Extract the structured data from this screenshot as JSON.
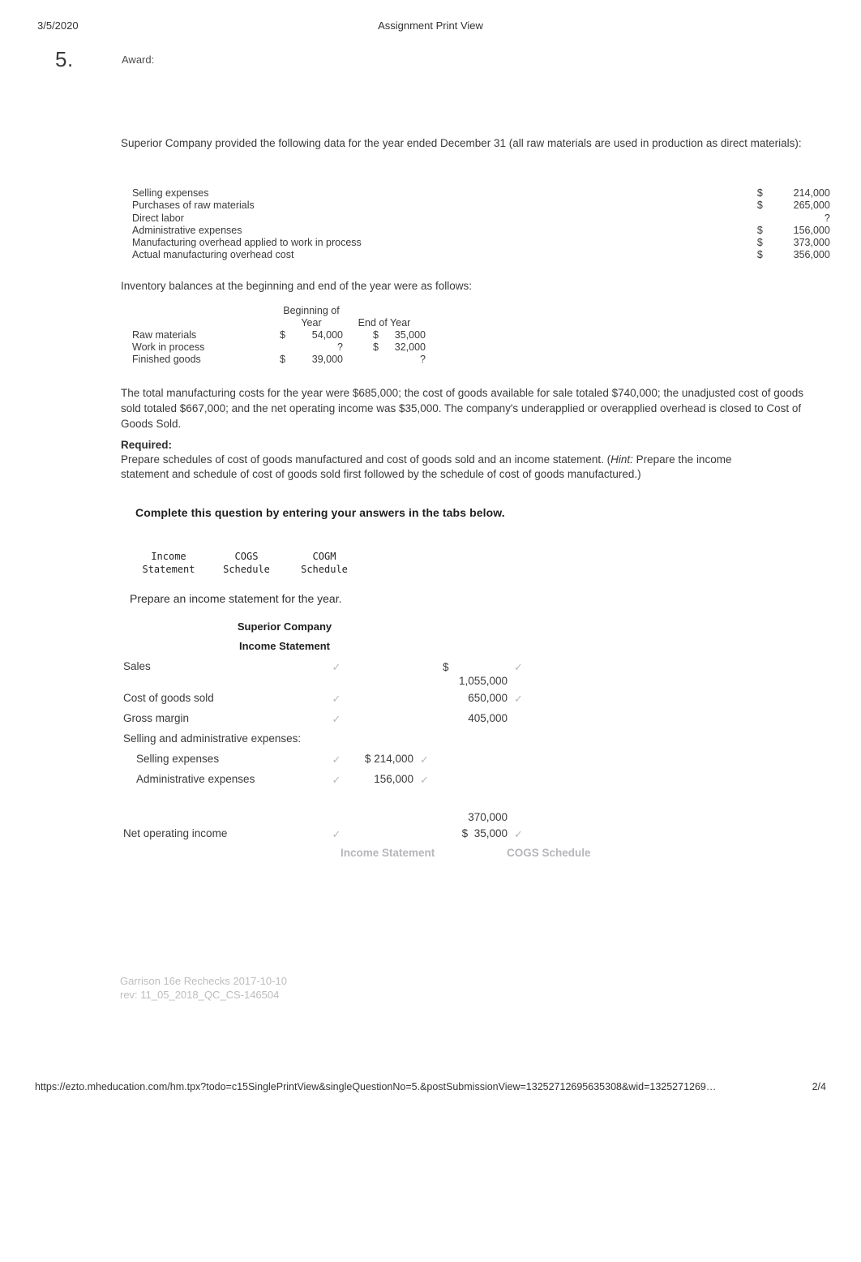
{
  "print_header": {
    "date": "3/5/2020",
    "title": "Assignment Print View"
  },
  "question": {
    "number": "5.",
    "award_label": "Award:"
  },
  "intro_text": "Superior Company provided the following data for the year ended December 31 (all raw materials are used in production as direct materials):",
  "given_data": {
    "rows": [
      {
        "label": "Selling expenses",
        "currency": "$",
        "amount": "214,000"
      },
      {
        "label": "Purchases of raw materials",
        "currency": "$",
        "amount": "265,000"
      },
      {
        "label": "Direct labor",
        "currency": "",
        "amount": "?"
      },
      {
        "label": "Administrative expenses",
        "currency": "$",
        "amount": "156,000"
      },
      {
        "label": "Manufacturing overhead applied to work in process",
        "currency": "$",
        "amount": "373,000"
      },
      {
        "label": "Actual manufacturing overhead cost",
        "currency": "$",
        "amount": "356,000"
      }
    ]
  },
  "inventory": {
    "lead_in": "Inventory balances at the beginning and end of the year were as follows:",
    "header_top": "Beginning of",
    "header_col1": "Year",
    "header_col2": "End of Year",
    "rows": [
      {
        "label": "Raw materials",
        "beg_cur": "$",
        "beg": "54,000",
        "end_cur": "$",
        "end": "35,000"
      },
      {
        "label": "Work in process",
        "beg_cur": "",
        "beg": "?",
        "end_cur": "$",
        "end": "32,000"
      },
      {
        "label": "Finished goods",
        "beg_cur": "$",
        "beg": "39,000",
        "end_cur": "",
        "end": "?"
      }
    ]
  },
  "paragraph2": "The total manufacturing costs for the year were $685,000; the cost of goods available for sale totaled $740,000; the unadjusted cost of goods sold totaled $667,000; and the net operating income was $35,000. The company's underapplied or overapplied overhead is closed to Cost of Goods Sold.",
  "required": {
    "label": "Required:",
    "text_before_hint": "Prepare schedules of cost of goods manufactured and cost of goods sold and an income statement. (",
    "hint_word": "Hint:",
    "text_after_hint": " Prepare the income statement and schedule of cost of goods sold first followed by the schedule of cost of goods manufactured.)"
  },
  "complete_instruction": "Complete this question by entering your answers in the tabs below.",
  "tabs": [
    {
      "line1": "Income",
      "line2": "Statement"
    },
    {
      "line1": "COGS",
      "line2": "Schedule"
    },
    {
      "line1": "COGM",
      "line2": "Schedule"
    }
  ],
  "tab_prompt": "Prepare an income statement for the year.",
  "income_statement": {
    "company": "Superior Company",
    "title": "Income Statement",
    "rows": [
      {
        "label": "Sales",
        "tick1": "✓",
        "amt1": "",
        "tick2": "",
        "cur2": "$",
        "amt2": "1,055,000",
        "tick3": "✓",
        "wrap": true
      },
      {
        "label": "Cost of goods sold",
        "tick1": "✓",
        "amt1": "",
        "tick2": "",
        "cur2": "",
        "amt2": "650,000",
        "tick3": "✓",
        "wrap": false
      },
      {
        "label": "Gross margin",
        "tick1": "✓",
        "amt1": "",
        "tick2": "",
        "cur2": "",
        "amt2": "405,000",
        "tick3": "",
        "wrap": false
      },
      {
        "label": "Selling and administrative expenses:",
        "tick1": "",
        "amt1": "",
        "tick2": "",
        "cur2": "",
        "amt2": "",
        "tick3": "",
        "wrap": false
      },
      {
        "label": "Selling expenses",
        "indent": true,
        "tick1": "✓",
        "cur1": "$",
        "amt1": "214,000",
        "tick2": "✓",
        "cur2": "",
        "amt2": "",
        "tick3": "",
        "wrap": false
      },
      {
        "label": "Administrative expenses",
        "indent": true,
        "tick1": "✓",
        "cur1": "",
        "amt1": "156,000",
        "tick2": "✓",
        "cur2": "",
        "amt2": "",
        "tick3": "",
        "wrap": false
      },
      {
        "label": "",
        "tick1": "",
        "amt1": "",
        "tick2": "",
        "cur2": "",
        "amt2": "370,000",
        "tick3": "",
        "wrap": false
      },
      {
        "label": "Net operating income",
        "tick1": "✓",
        "amt1": "",
        "tick2": "",
        "cur2": "$",
        "amt2": "35,000",
        "tick3": "✓",
        "wrap": false
      }
    ]
  },
  "bottom_nav": {
    "prev": "Income Statement",
    "next": "COGS Schedule"
  },
  "source_footer": {
    "line1": "Garrison 16e Rechecks 2017-10-10",
    "line2": "rev: 11_05_2018_QC_CS-146504"
  },
  "url_footer": {
    "url": "https://ezto.mheducation.com/hm.tpx?todo=c15SinglePrintView&singleQuestionNo=5.&postSubmissionView=13252712695635308&wid=1325271269…",
    "page": "2/4"
  },
  "colors": {
    "text": "#3a3a3a",
    "muted": "#bdbdbd",
    "tick": "#b7b7b7",
    "navlink": "#b6b6bb"
  }
}
